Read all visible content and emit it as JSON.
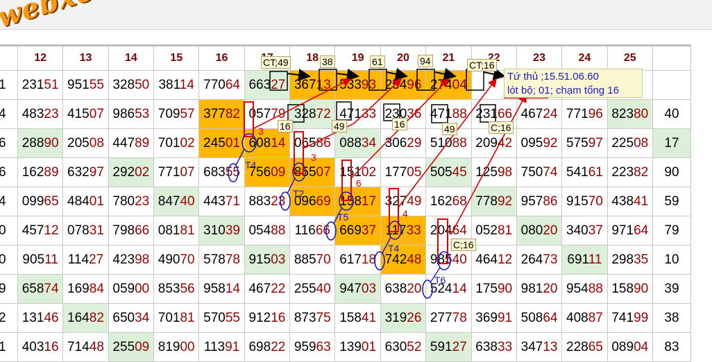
{
  "site_logo": "webxoso.net",
  "columns": [
    "12",
    "13",
    "14",
    "15",
    "16",
    "17",
    "18",
    "19",
    "20",
    "21",
    "22",
    "23",
    "24",
    "25",
    ""
  ],
  "rows": [
    [
      [
        "01",
        ""
      ],
      [
        "231",
        "51"
      ],
      [
        "951",
        "55"
      ],
      [
        "328",
        "50"
      ],
      [
        "381",
        "14"
      ],
      [
        "770",
        "64"
      ],
      [
        "663",
        "27"
      ],
      [
        "367",
        "13"
      ],
      [
        "533",
        "93"
      ],
      [
        "254",
        "96"
      ],
      [
        "274",
        "04"
      ],
      [
        "",
        ""
      ],
      [
        "",
        ""
      ],
      [
        "",
        ""
      ],
      [
        "",
        ""
      ],
      [
        "",
        ""
      ]
    ],
    [
      [
        "94",
        ""
      ],
      [
        "483",
        "23"
      ],
      [
        "415",
        "07"
      ],
      [
        "986",
        "53"
      ],
      [
        "709",
        "57"
      ],
      [
        "377",
        "82"
      ],
      [
        "057",
        "79"
      ],
      [
        "328",
        "72"
      ],
      [
        "471",
        "33"
      ],
      [
        "230",
        "36"
      ],
      [
        "471",
        "88"
      ],
      [
        "231",
        "66"
      ],
      [
        "467",
        "24"
      ],
      [
        "771",
        "96"
      ],
      [
        "823",
        "80"
      ],
      [
        "40",
        ""
      ]
    ],
    [
      [
        "16",
        ""
      ],
      [
        "288",
        "90"
      ],
      [
        "205",
        "08"
      ],
      [
        "447",
        "89"
      ],
      [
        "701",
        "02"
      ],
      [
        "245",
        "01"
      ],
      [
        "608",
        "14"
      ],
      [
        "065",
        "86"
      ],
      [
        "088",
        "34"
      ],
      [
        "306",
        "29"
      ],
      [
        "510",
        "88"
      ],
      [
        "209",
        "42"
      ],
      [
        "095",
        "92"
      ],
      [
        "575",
        "97"
      ],
      [
        "225",
        "08"
      ],
      [
        "17",
        ""
      ]
    ],
    [
      [
        "66",
        ""
      ],
      [
        "162",
        "89"
      ],
      [
        "632",
        "97"
      ],
      [
        "292",
        "02"
      ],
      [
        "771",
        "07"
      ],
      [
        "683",
        "55"
      ],
      [
        "756",
        "09"
      ],
      [
        "855",
        "07"
      ],
      [
        "151",
        "02"
      ],
      [
        "177",
        "05"
      ],
      [
        "505",
        "45"
      ],
      [
        "125",
        "98"
      ],
      [
        "750",
        "74"
      ],
      [
        "541",
        "61"
      ],
      [
        "223",
        "82"
      ],
      [
        "90",
        ""
      ]
    ],
    [
      [
        "54",
        ""
      ],
      [
        "099",
        "65"
      ],
      [
        "484",
        "01"
      ],
      [
        "780",
        "23"
      ],
      [
        "847",
        "40"
      ],
      [
        "443",
        "71"
      ],
      [
        "883",
        "23"
      ],
      [
        "096",
        "69"
      ],
      [
        "158",
        "17"
      ],
      [
        "327",
        "49"
      ],
      [
        "162",
        "68"
      ],
      [
        "778",
        "92"
      ],
      [
        "957",
        "86"
      ],
      [
        "915",
        "70"
      ],
      [
        "438",
        "41"
      ],
      [
        "59",
        ""
      ]
    ],
    [
      [
        "10",
        ""
      ],
      [
        "457",
        "12"
      ],
      [
        "078",
        "31"
      ],
      [
        "798",
        "66"
      ],
      [
        "081",
        "81"
      ],
      [
        "310",
        "39"
      ],
      [
        "054",
        "88"
      ],
      [
        "116",
        "66"
      ],
      [
        "669",
        "37"
      ],
      [
        "117",
        "33"
      ],
      [
        "204",
        "64"
      ],
      [
        "052",
        "81"
      ],
      [
        "080",
        "20"
      ],
      [
        "340",
        "37"
      ],
      [
        "971",
        "64"
      ],
      [
        "79",
        ""
      ]
    ],
    [
      [
        "90",
        ""
      ],
      [
        "905",
        "11"
      ],
      [
        "114",
        "27"
      ],
      [
        "423",
        "98"
      ],
      [
        "490",
        "70"
      ],
      [
        "578",
        "78"
      ],
      [
        "915",
        "03"
      ],
      [
        "885",
        "70"
      ],
      [
        "617",
        "18"
      ],
      [
        "742",
        "48"
      ],
      [
        "985",
        "40"
      ],
      [
        "464",
        "12"
      ],
      [
        "264",
        "73"
      ],
      [
        "691",
        "11"
      ],
      [
        "298",
        "35"
      ],
      [
        "10",
        ""
      ]
    ],
    [
      [
        "09",
        ""
      ],
      [
        "658",
        "74"
      ],
      [
        "169",
        "84"
      ],
      [
        "059",
        "00"
      ],
      [
        "853",
        "56"
      ],
      [
        "958",
        "14"
      ],
      [
        "467",
        "22"
      ],
      [
        "255",
        "40"
      ],
      [
        "947",
        "03"
      ],
      [
        "638",
        "20"
      ],
      [
        "524",
        "14"
      ],
      [
        "175",
        "90"
      ],
      [
        "981",
        "20"
      ],
      [
        "954",
        "88"
      ],
      [
        "158",
        "90"
      ],
      [
        "39",
        ""
      ]
    ],
    [
      [
        "52",
        ""
      ],
      [
        "131",
        "46"
      ],
      [
        "164",
        "82"
      ],
      [
        "650",
        "34"
      ],
      [
        "701",
        "81"
      ],
      [
        "570",
        "55"
      ],
      [
        "912",
        "16"
      ],
      [
        "873",
        "75"
      ],
      [
        "158",
        "41"
      ],
      [
        "319",
        "26"
      ],
      [
        "277",
        "78"
      ],
      [
        "369",
        "91"
      ],
      [
        "508",
        "64"
      ],
      [
        "408",
        "87"
      ],
      [
        "741",
        "99"
      ],
      [
        "38",
        ""
      ]
    ],
    [
      [
        "01",
        ""
      ],
      [
        "403",
        "16"
      ],
      [
        "714",
        "48"
      ],
      [
        "255",
        "09"
      ],
      [
        "819",
        "00"
      ],
      [
        "113",
        "91"
      ],
      [
        "698",
        "22"
      ],
      [
        "959",
        "63"
      ],
      [
        "139",
        "01"
      ],
      [
        "630",
        "52"
      ],
      [
        "591",
        "27"
      ],
      [
        "638",
        "33"
      ],
      [
        "347",
        "13"
      ],
      [
        "228",
        "65"
      ],
      [
        "089",
        "04"
      ],
      [
        "83",
        ""
      ]
    ]
  ],
  "cell_fill": [
    [
      "n",
      "n",
      "n",
      "n",
      "n",
      "n",
      "g",
      "o",
      "o",
      "o",
      "o",
      "n",
      "n",
      "n",
      "n",
      "n"
    ],
    [
      "n",
      "n",
      "n",
      "n",
      "n",
      "o",
      "n",
      "g",
      "n",
      "n",
      "n",
      "n",
      "n",
      "n",
      "g",
      "n"
    ],
    [
      "n",
      "g",
      "n",
      "n",
      "n",
      "o",
      "o",
      "n",
      "g",
      "n",
      "n",
      "n",
      "n",
      "n",
      "n",
      "g"
    ],
    [
      "n",
      "n",
      "n",
      "g",
      "n",
      "n",
      "o",
      "o",
      "n",
      "n",
      "g",
      "n",
      "n",
      "n",
      "n",
      "n"
    ],
    [
      "n",
      "n",
      "n",
      "n",
      "g",
      "n",
      "n",
      "o",
      "o",
      "n",
      "n",
      "g",
      "n",
      "n",
      "n",
      "n"
    ],
    [
      "n",
      "n",
      "n",
      "n",
      "n",
      "g",
      "n",
      "n",
      "o",
      "o",
      "n",
      "n",
      "g",
      "n",
      "n",
      "n"
    ],
    [
      "n",
      "n",
      "n",
      "n",
      "n",
      "n",
      "g",
      "n",
      "n",
      "o",
      "n",
      "n",
      "n",
      "g",
      "n",
      "n"
    ],
    [
      "n",
      "g",
      "n",
      "n",
      "n",
      "n",
      "n",
      "n",
      "g",
      "n",
      "n",
      "n",
      "n",
      "n",
      "n",
      "n"
    ],
    [
      "n",
      "n",
      "g",
      "n",
      "n",
      "n",
      "n",
      "n",
      "n",
      "g",
      "n",
      "n",
      "n",
      "n",
      "n",
      "n"
    ],
    [
      "n",
      "n",
      "n",
      "g",
      "n",
      "n",
      "n",
      "n",
      "n",
      "n",
      "g",
      "n",
      "n",
      "n",
      "n",
      "n"
    ]
  ],
  "annotations": {
    "ct49": "CT;49",
    "n38": "38",
    "n61": "61",
    "n94": "94",
    "ct16": "CT;16",
    "box16": "16",
    "box49a": "49",
    "box16b": "16",
    "box49b": "49",
    "c16a": "C;16",
    "c16b": "C;16",
    "r3a": "3",
    "r3b": "3",
    "r6": "6",
    "r4": "4",
    "t4a": "T4",
    "t2": "T2",
    "t5": "T5",
    "t4b": "T4",
    "t6": "T6"
  },
  "note": {
    "line1": "Tứ thủ ;15.51.06.60",
    "line2": "lót bộ; 01; chạm tổng 16"
  },
  "colors": {
    "highlight": "#ffb700",
    "green": "#dcefd8",
    "header_text": "#7a0000",
    "digit_red": "#9b0000",
    "pen_red": "#e00000",
    "pen_blue": "#1a1acc"
  }
}
